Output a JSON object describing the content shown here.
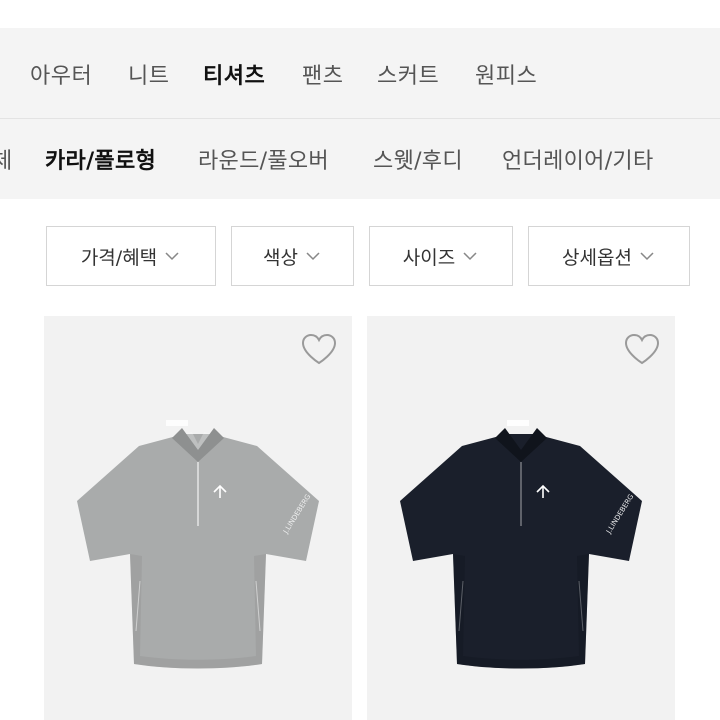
{
  "main_categories": [
    {
      "label": "아우터",
      "active": false
    },
    {
      "label": "니트",
      "active": false
    },
    {
      "label": "티셔츠",
      "active": true
    },
    {
      "label": "팬츠",
      "active": false
    },
    {
      "label": "스커트",
      "active": false
    },
    {
      "label": "원피스",
      "active": false
    }
  ],
  "sub_categories": [
    {
      "label": "체",
      "active": false
    },
    {
      "label": "카라/폴로형",
      "active": true
    },
    {
      "label": "라운드/풀오버",
      "active": false
    },
    {
      "label": "스웻/후디",
      "active": false
    },
    {
      "label": "언더레이어/기타",
      "active": false
    }
  ],
  "filters": [
    {
      "label": "가격/혜택",
      "icon": "chevron-down-icon"
    },
    {
      "label": "색상",
      "icon": "chevron-down-icon"
    },
    {
      "label": "사이즈",
      "icon": "chevron-down-icon"
    },
    {
      "label": "상세옵션",
      "icon": "chevron-down-icon"
    }
  ],
  "products": [
    {
      "color": "#a9abab",
      "color_dark": "#8e9090",
      "wishlisted": false
    },
    {
      "color": "#1a1f2b",
      "color_dark": "#10141c",
      "wishlisted": false
    }
  ],
  "colors": {
    "category_bg": "#f4f4f4",
    "card_bg": "#f2f2f2",
    "active_text": "#111111",
    "inactive_text": "#555555",
    "border": "#d5d5d5"
  }
}
